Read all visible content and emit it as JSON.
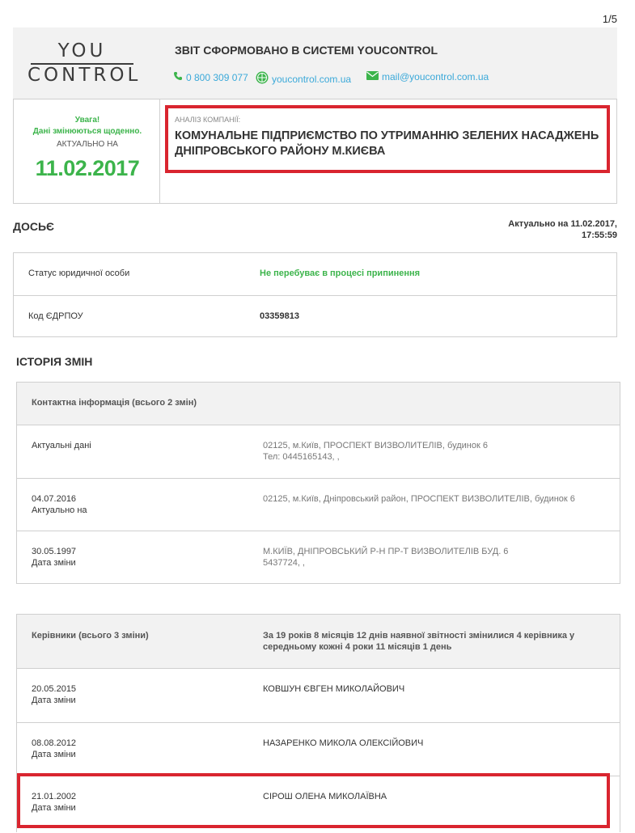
{
  "page_number": "1/5",
  "header": {
    "logo_line1": "YOU",
    "logo_line2": "CONTROL",
    "title": "ЗВІТ СФОРМОВАНО В СИСТЕМІ YOUCONTROL",
    "phone": "0 800 309 077",
    "website": "youcontrol.com.ua",
    "email": "mail@youcontrol.com.ua",
    "icons": {
      "phone": "phone-icon",
      "website": "globe-icon",
      "email": "envelope-icon"
    },
    "colors": {
      "link": "#3ba9d9",
      "green": "#3cb44b",
      "highlight": "#d9252f"
    }
  },
  "notice": {
    "line1": "Увага!",
    "line2": "Дані змінюються щоденно.",
    "line3": "АКТУАЛЬНО НА",
    "date": "11.02.2017"
  },
  "company": {
    "label": "АНАЛІЗ КОМПАНІЇ:",
    "name": "КОМУНАЛЬНЕ ПІДПРИЄМСТВО ПО УТРИМАННЮ ЗЕЛЕНИХ НАСАДЖЕНЬ ДНІПРОВСЬКОГО РАЙОНУ М.КИЄВА"
  },
  "dossier": {
    "title": "ДОСЬЄ",
    "actual_line1": "Актуально на 11.02.2017,",
    "actual_line2": "17:55:59",
    "rows": [
      {
        "label": "Статус юридичної особи",
        "value": "Не перебуває в процесі припинення"
      },
      {
        "label": "Код ЄДРПОУ",
        "value": "03359813"
      }
    ]
  },
  "history": {
    "title": "ІСТОРІЯ ЗМІН",
    "contacts": {
      "header": "Контактна інформація (всього 2 змін)",
      "rows": [
        {
          "date": "Актуальні дані",
          "note": "",
          "line1": "02125, м.Київ, ПРОСПЕКТ ВИЗВОЛИТЕЛІВ, будинок 6",
          "line2": "Тел: 0445165143, ,"
        },
        {
          "date": "04.07.2016",
          "note": "Актуально на",
          "line1": "02125, м.Київ, Дніпровський район, ПРОСПЕКТ ВИЗВОЛИТЕЛІВ, будинок 6",
          "line2": ""
        },
        {
          "date": "30.05.1997",
          "note": "Дата зміни",
          "line1": "М.КИЇВ, ДНІПРОВСЬКИЙ Р-Н ПР-Т ВИЗВОЛИТЕЛІВ БУД. 6",
          "line2": "5437724, ,"
        }
      ]
    },
    "leaders": {
      "header": "Керівники (всього 3 зміни)",
      "summary_line1": "За 19 років 8 місяців 12 днів наявної звітності змінилися 4 керівника у",
      "summary_line2": "середньому кожні 4 роки 11 місяців 1 день",
      "rows": [
        {
          "date": "20.05.2015",
          "note": "Дата зміни",
          "name": "КОВШУН ЄВГЕН МИКОЛАЙОВИЧ"
        },
        {
          "date": "08.08.2012",
          "note": "Дата зміни",
          "name": "НАЗАРЕНКО МИКОЛА ОЛЕКСІЙОВИЧ"
        },
        {
          "date": "21.01.2002",
          "note": "Дата зміни",
          "name": "СІРОШ ОЛЕНА МИКОЛАЇВНА"
        }
      ]
    }
  }
}
